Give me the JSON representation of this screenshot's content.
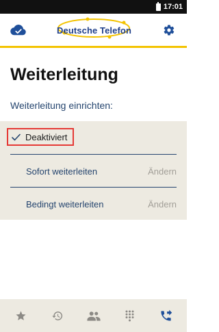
{
  "status_bar": {
    "time": "17:01"
  },
  "header": {
    "logo_text": "Deutsche Telefon",
    "cloud_icon": "cloud-check-icon",
    "settings_icon": "gear-icon"
  },
  "page": {
    "title": "Weiterleitung",
    "section_label": "Weiterleitung einrichten:"
  },
  "options": {
    "deactivated": {
      "label": "Deaktiviert",
      "selected": true
    },
    "immediate": {
      "label": "Sofort weiterleiten",
      "action": "Ändern"
    },
    "conditional": {
      "label": "Bedingt weiterleiten",
      "action": "Ändern"
    }
  },
  "bottom_nav": [
    {
      "icon": "star-icon",
      "active": false
    },
    {
      "icon": "history-icon",
      "active": false
    },
    {
      "icon": "contacts-icon",
      "active": false
    },
    {
      "icon": "dialpad-icon",
      "active": false
    },
    {
      "icon": "call-forward-icon",
      "active": true
    }
  ],
  "colors": {
    "brand_blue": "#1f4f9a",
    "accent_yellow": "#f3c300",
    "text_blue": "#24446e",
    "panel_bg": "#edeae1",
    "highlight_red": "#e53935"
  }
}
